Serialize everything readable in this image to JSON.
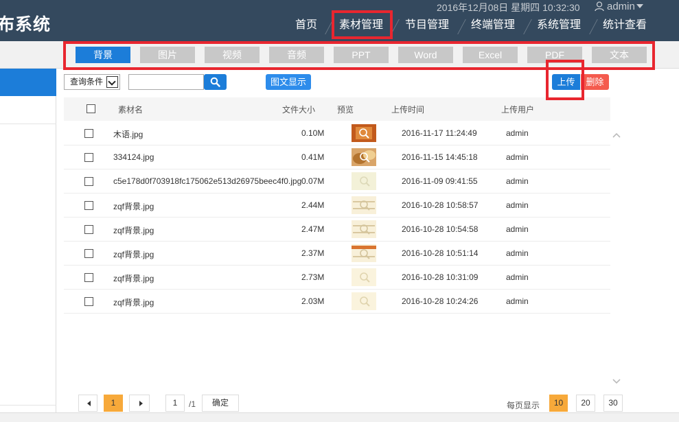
{
  "header": {
    "app_title": "布系统",
    "clock": "2016年12月08日 星期四 10:32:30",
    "user": "admin",
    "nav": [
      "首页",
      "素材管理",
      "节目管理",
      "终端管理",
      "系统管理",
      "统计查看"
    ]
  },
  "type_tabs": [
    "背景",
    "图片",
    "视频",
    "音频",
    "PPT",
    "Word",
    "Excel",
    "PDF",
    "文本"
  ],
  "toolbar": {
    "query_label": "查询条件",
    "search_value": "",
    "view_label": "图文显示",
    "upload_label": "上传",
    "delete_label": "删除"
  },
  "table": {
    "columns": [
      "素材名",
      "文件大小",
      "预览",
      "上传时间",
      "上传用户"
    ],
    "rows": [
      {
        "name": "木语.jpg",
        "size": "0.10M",
        "time": "2016-11-17 11:24:49",
        "user": "admin"
      },
      {
        "name": "334124.jpg",
        "size": "0.41M",
        "time": "2016-11-15 14:45:18",
        "user": "admin"
      },
      {
        "name": "c5e178d0f703918fc175062e513d26975beec4f0.jpg",
        "size": "0.07M",
        "time": "2016-11-09 09:41:55",
        "user": "admin"
      },
      {
        "name": "zqf背景.jpg",
        "size": "2.44M",
        "time": "2016-10-28 10:58:57",
        "user": "admin"
      },
      {
        "name": "zqf背景.jpg",
        "size": "2.47M",
        "time": "2016-10-28 10:54:58",
        "user": "admin"
      },
      {
        "name": "zqf背景.jpg",
        "size": "2.37M",
        "time": "2016-10-28 10:51:14",
        "user": "admin"
      },
      {
        "name": "zqf背景.jpg",
        "size": "2.73M",
        "time": "2016-10-28 10:31:09",
        "user": "admin"
      },
      {
        "name": "zqf背景.jpg",
        "size": "2.03M",
        "time": "2016-10-28 10:24:26",
        "user": "admin"
      }
    ]
  },
  "pager": {
    "current_page": "1",
    "page_input": "1",
    "total_pages": "/1",
    "confirm_label": "确定",
    "per_page_label": "每页显示",
    "per_page_options": [
      "10",
      "20",
      "30"
    ]
  },
  "colors": {
    "header_bg": "#34495e",
    "accent": "#1c7dd9",
    "danger": "#f45b4e",
    "pager_active": "#f7a93a",
    "highlight": "#e8262f"
  }
}
